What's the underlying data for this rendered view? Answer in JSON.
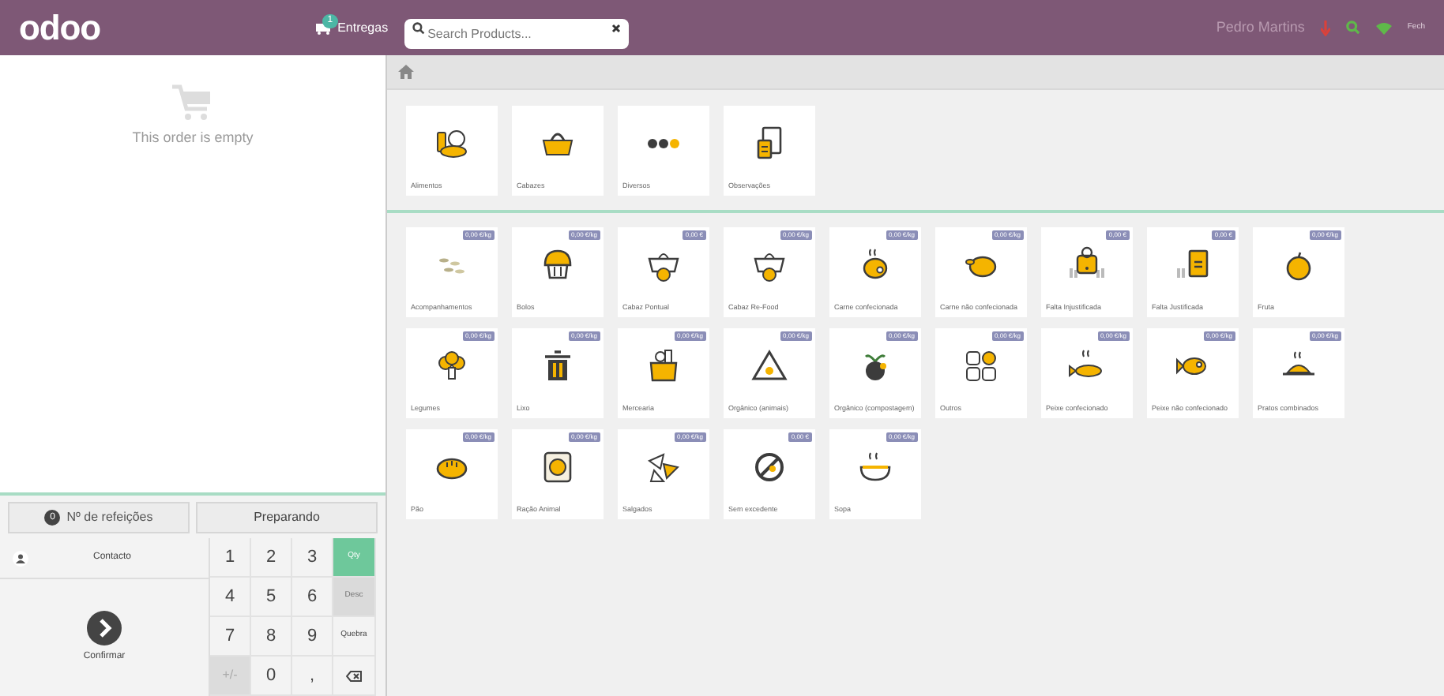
{
  "header": {
    "logo": "odoo",
    "deliveries": {
      "label": "Entregas",
      "count": "1"
    },
    "search": {
      "placeholder": "Search Products..."
    },
    "user": "Pedro Martins",
    "close_label": "Fech"
  },
  "order": {
    "empty_message": "This order is empty",
    "meals": {
      "count": "0",
      "label": "Nº de refeições"
    },
    "status_button": "Preparando",
    "customer_button": "Contacto",
    "confirm_button": "Confirmar",
    "numpad": [
      {
        "kind": "digit",
        "label": "1"
      },
      {
        "kind": "digit",
        "label": "2"
      },
      {
        "kind": "digit",
        "label": "3"
      },
      {
        "kind": "mode",
        "label": "Qty",
        "selected": true,
        "disabled": false
      },
      {
        "kind": "digit",
        "label": "4"
      },
      {
        "kind": "digit",
        "label": "5"
      },
      {
        "kind": "digit",
        "label": "6"
      },
      {
        "kind": "mode",
        "label": "Desc",
        "selected": false,
        "disabled": true
      },
      {
        "kind": "digit",
        "label": "7"
      },
      {
        "kind": "digit",
        "label": "8"
      },
      {
        "kind": "digit",
        "label": "9"
      },
      {
        "kind": "mode",
        "label": "Quebra",
        "selected": false,
        "disabled": false
      },
      {
        "kind": "sign",
        "label": "+/-"
      },
      {
        "kind": "digit",
        "label": "0"
      },
      {
        "kind": "digit",
        "label": ","
      },
      {
        "kind": "backspace"
      }
    ]
  },
  "categories": [
    {
      "name": "Alimentos"
    },
    {
      "name": "Cabazes"
    },
    {
      "name": "Diversos"
    },
    {
      "name": "Observações"
    }
  ],
  "products": [
    {
      "name": "Acompanhamentos",
      "price": "0,00 €/kg"
    },
    {
      "name": "Bolos",
      "price": "0,00 €/kg"
    },
    {
      "name": "Cabaz Pontual",
      "price": "0,00 €"
    },
    {
      "name": "Cabaz Re-Food",
      "price": "0,00 €/kg"
    },
    {
      "name": "Carne confecionada",
      "price": "0,00 €/kg"
    },
    {
      "name": "Carne não confecionada",
      "price": "0,00 €/kg"
    },
    {
      "name": "Falta Injustificada",
      "price": "0,00 €"
    },
    {
      "name": "Falta Justificada",
      "price": "0,00 €"
    },
    {
      "name": "Fruta",
      "price": "0,00 €/kg"
    },
    {
      "name": "Legumes",
      "price": "0,00 €/kg"
    },
    {
      "name": "Lixo",
      "price": "0,00 €/kg"
    },
    {
      "name": "Mercearia",
      "price": "0,00 €/kg"
    },
    {
      "name": "Orgânico (animais)",
      "price": "0,00 €/kg"
    },
    {
      "name": "Orgânico (compostagem)",
      "price": "0,00 €/kg"
    },
    {
      "name": "Outros",
      "price": "0,00 €/kg"
    },
    {
      "name": "Peixe confecionado",
      "price": "0,00 €/kg"
    },
    {
      "name": "Peixe não confecionado",
      "price": "0,00 €/kg"
    },
    {
      "name": "Pratos combinados",
      "price": "0,00 €/kg"
    },
    {
      "name": "Pão",
      "price": "0,00 €/kg"
    },
    {
      "name": "Ração Animal",
      "price": "0,00 €/kg"
    },
    {
      "name": "Salgados",
      "price": "0,00 €/kg"
    },
    {
      "name": "Sem excedente",
      "price": "0,00 €"
    },
    {
      "name": "Sopa",
      "price": "0,00 €/kg"
    }
  ]
}
